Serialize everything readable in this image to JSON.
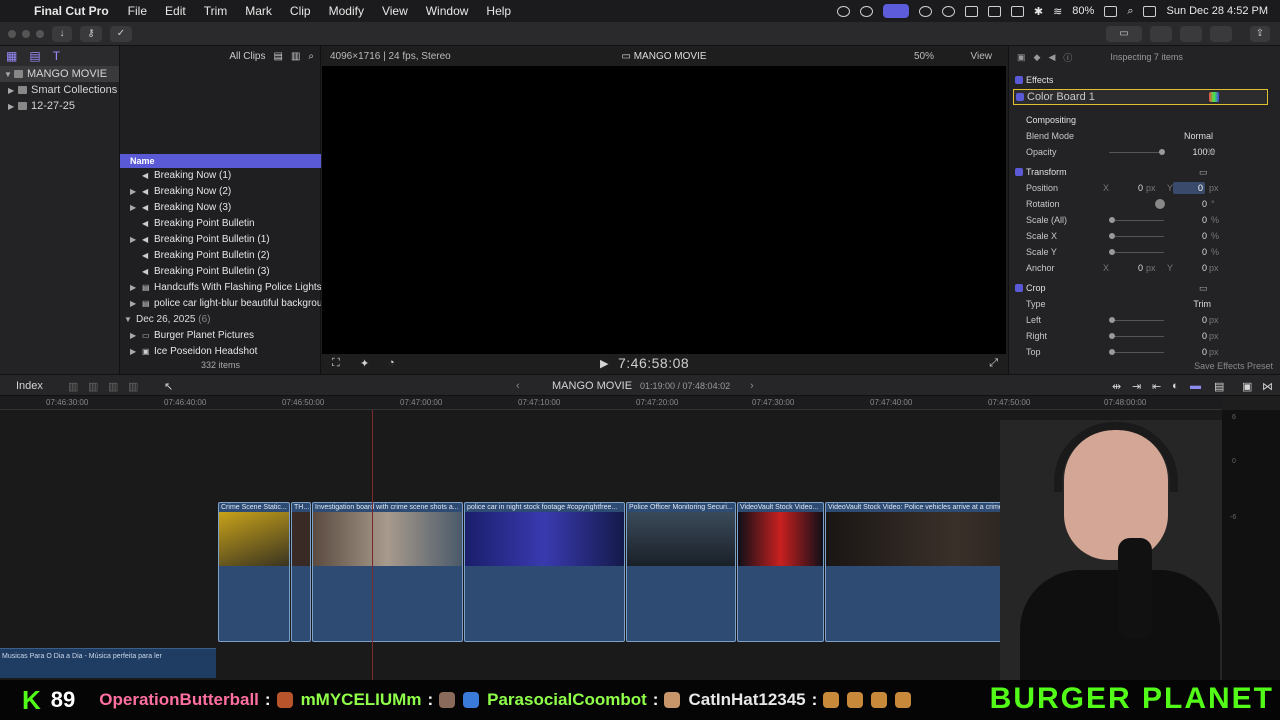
{
  "menubar": {
    "app_name": "Final Cut Pro",
    "items": [
      "File",
      "Edit",
      "Trim",
      "Mark",
      "Clip",
      "Modify",
      "View",
      "Window",
      "Help"
    ],
    "battery": "80%",
    "datetime": "Sun Dec 28  4:52 PM"
  },
  "browser": {
    "library": "MANGO MOVIE",
    "sidebar_items": [
      {
        "label": "Smart Collections"
      },
      {
        "label": "12-27-25"
      }
    ],
    "filter": "All Clips",
    "name_header": "Name",
    "rows": [
      {
        "label": "Breaking Now (1)",
        "expandable": false
      },
      {
        "label": "Breaking Now (2)",
        "expandable": true
      },
      {
        "label": "Breaking Now (3)",
        "expandable": true
      },
      {
        "label": "Breaking Point Bulletin",
        "expandable": false
      },
      {
        "label": "Breaking Point Bulletin (1)",
        "expandable": true
      },
      {
        "label": "Breaking Point Bulletin (2)",
        "expandable": false
      },
      {
        "label": "Breaking Point Bulletin (3)",
        "expandable": false
      },
      {
        "label": "Handcuffs With Flashing Police Lights Stock",
        "expandable": true
      },
      {
        "label": "police car light-blur beautiful background",
        "expandable": true
      }
    ],
    "date_group": {
      "label": "Dec 26, 2025",
      "count": "(6)"
    },
    "rows2": [
      {
        "label": "Burger Planet Pictures"
      },
      {
        "label": "Ice Poseidon Headshot"
      }
    ],
    "item_count": "332 items"
  },
  "viewer": {
    "format": "4096×1716 | 24 fps, Stereo",
    "project": "MANGO MOVIE",
    "zoom": "50%",
    "view_label": "View",
    "timecode": "7:46:58:08"
  },
  "inspector": {
    "status": "Inspecting 7 items",
    "effects": "Effects",
    "effect_item": "Color Board 1",
    "compositing": "Compositing",
    "blend_mode_label": "Blend Mode",
    "blend_mode_value": "Normal",
    "opacity_label": "Opacity",
    "opacity_value": "100.0",
    "opacity_unit": "%",
    "transform": "Transform",
    "position_label": "Position",
    "position_x": "0",
    "position_y": "0",
    "rotation_label": "Rotation",
    "rotation_value": "0",
    "rotation_unit": "°",
    "scale_all_label": "Scale (All)",
    "scale_all_value": "0",
    "scale_x_label": "Scale X",
    "scale_x_value": "0",
    "scale_y_label": "Scale Y",
    "scale_y_value": "0",
    "anchor_label": "Anchor",
    "anchor_x": "0",
    "anchor_y": "0",
    "crop": "Crop",
    "type_label": "Type",
    "type_value": "Trim",
    "left_label": "Left",
    "left_value": "0",
    "right_label": "Right",
    "right_value": "0",
    "top_label": "Top",
    "top_value": "0",
    "px": "px",
    "pct": "%",
    "x": "X",
    "y": "Y",
    "save_preset": "Save Effects Preset"
  },
  "timeline": {
    "index": "Index",
    "project": "MANGO MOVIE",
    "duration": "01:19:00 / 07:48:04:02",
    "ruler": [
      "07:46:30:00",
      "07:46:40:00",
      "07:46:50:00",
      "07:47:00:00",
      "07:47:10:00",
      "07:47:20:00",
      "07:47:30:00",
      "07:47:40:00",
      "07:47:50:00",
      "07:48:00:00"
    ],
    "clips": [
      {
        "title": "Crime Scene Static..."
      },
      {
        "title": "TH..."
      },
      {
        "title": "Investigation board with crime scene shots a..."
      },
      {
        "title": "police  car in night stock footage #copyrightfree..."
      },
      {
        "title": "Police Officer Monitoring Securi..."
      },
      {
        "title": "VideoVault Stock Video..."
      },
      {
        "title": "VideoVault Stock Video:  Police vehicles arrive at a crime scene"
      }
    ],
    "audio_clip": "Musicas Para O Dia a Dia - Música perfeita para ler"
  },
  "ticker": {
    "k_logo": "K",
    "viewer_count": "89",
    "users": [
      {
        "name": "OperationButterball",
        "color": "#ff6fa0"
      },
      {
        "name": "mMYCELIUMm",
        "color": "#8fff4a"
      },
      {
        "name": "ParasocialCoombot",
        "color": "#8fff4a"
      },
      {
        "name": "CatInHat12345",
        "color": "#e8e8e8"
      }
    ],
    "brand": "BURGER PLANET"
  }
}
